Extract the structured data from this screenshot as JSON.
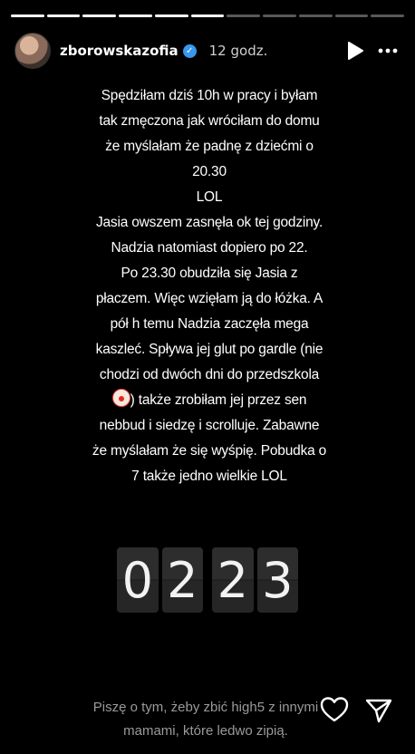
{
  "progress": {
    "segments_total": 11,
    "segments_done": 6
  },
  "header": {
    "username": "zborowskazofia",
    "verified": true,
    "time": "12 godz."
  },
  "story": {
    "lines": [
      "Spędziłam dziś 10h w pracy i byłam",
      "tak zmęczona jak wróciłam do domu",
      "że myślałam że padnę z dziećmi o",
      "20.30",
      "LOL",
      "Jasia owszem zasnęła ok tej godziny.",
      "Nadzia natomiast dopiero po 22.",
      "Po 23.30 obudziła się Jasia z",
      "płaczem. Więc wzięłam ją do łóżka. A",
      "pół h temu Nadzia zaczęła mega",
      "kaszleć. Spływa jej glut po gardle (nie",
      "chodzi od dwóch dni do przedszkola",
      ") także zrobiłam jej przez sen",
      "nebbud i siedzę i scrolluje. Zabawne",
      "że myślałam że się wyśpię. Pobudka o",
      "7 także jedno wielkie LOL"
    ],
    "emoji": "clown-face"
  },
  "clock": {
    "digits": [
      "0",
      "2",
      "2",
      "3"
    ]
  },
  "reply": {
    "line1": "Piszę o tym, żeby zbić high5 z innymi",
    "line2": "mamami, które ledwo zipią."
  },
  "icons": {
    "play": "play-icon",
    "more": "more-icon",
    "like": "heart-icon",
    "share": "send-icon"
  }
}
